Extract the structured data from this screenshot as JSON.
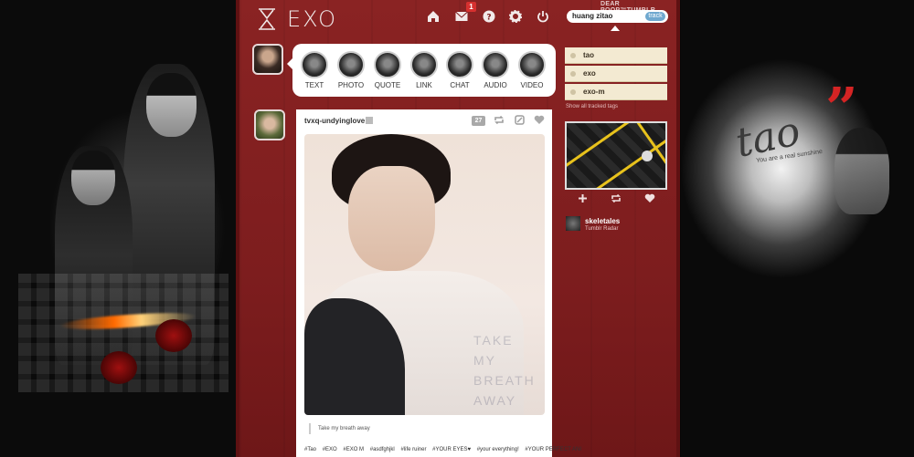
{
  "header": {
    "logo_text": "EXO",
    "blog_label": "DEAR POOP™TUMBLR",
    "inbox_badge": "1",
    "nav": [
      "home-icon",
      "mail-icon",
      "help-icon",
      "gear-icon",
      "power-icon"
    ]
  },
  "search": {
    "value": "huang zitao",
    "track_label": "track"
  },
  "post_types": [
    {
      "label": "TEXT"
    },
    {
      "label": "PHOTO"
    },
    {
      "label": "QUOTE"
    },
    {
      "label": "LINK"
    },
    {
      "label": "CHAT"
    },
    {
      "label": "AUDIO"
    },
    {
      "label": "VIDEO"
    }
  ],
  "post": {
    "author": "tvxq-undyinglove",
    "notes": "27",
    "overlay_text": [
      "TAKE",
      "MY BREATH",
      "AWAY"
    ],
    "caption": "Take my breath away",
    "tags": [
      "#Tao",
      "#EXO",
      "#EXO M",
      "#asdfghjkl",
      "#life ruiner",
      "#YOUR EYES♥",
      "#your everything!",
      "#YOUR PERFECT ANI"
    ]
  },
  "sidebar": {
    "tracked_tags": [
      "tao",
      "exo",
      "exo-m"
    ],
    "show_all_label": "Show all tracked tags",
    "radar_user": "skeletales",
    "radar_label": "Tumblr Radar"
  },
  "art": {
    "right_script": "tao",
    "right_sub": "You are a real sunshine",
    "quote_glyph": "”"
  }
}
